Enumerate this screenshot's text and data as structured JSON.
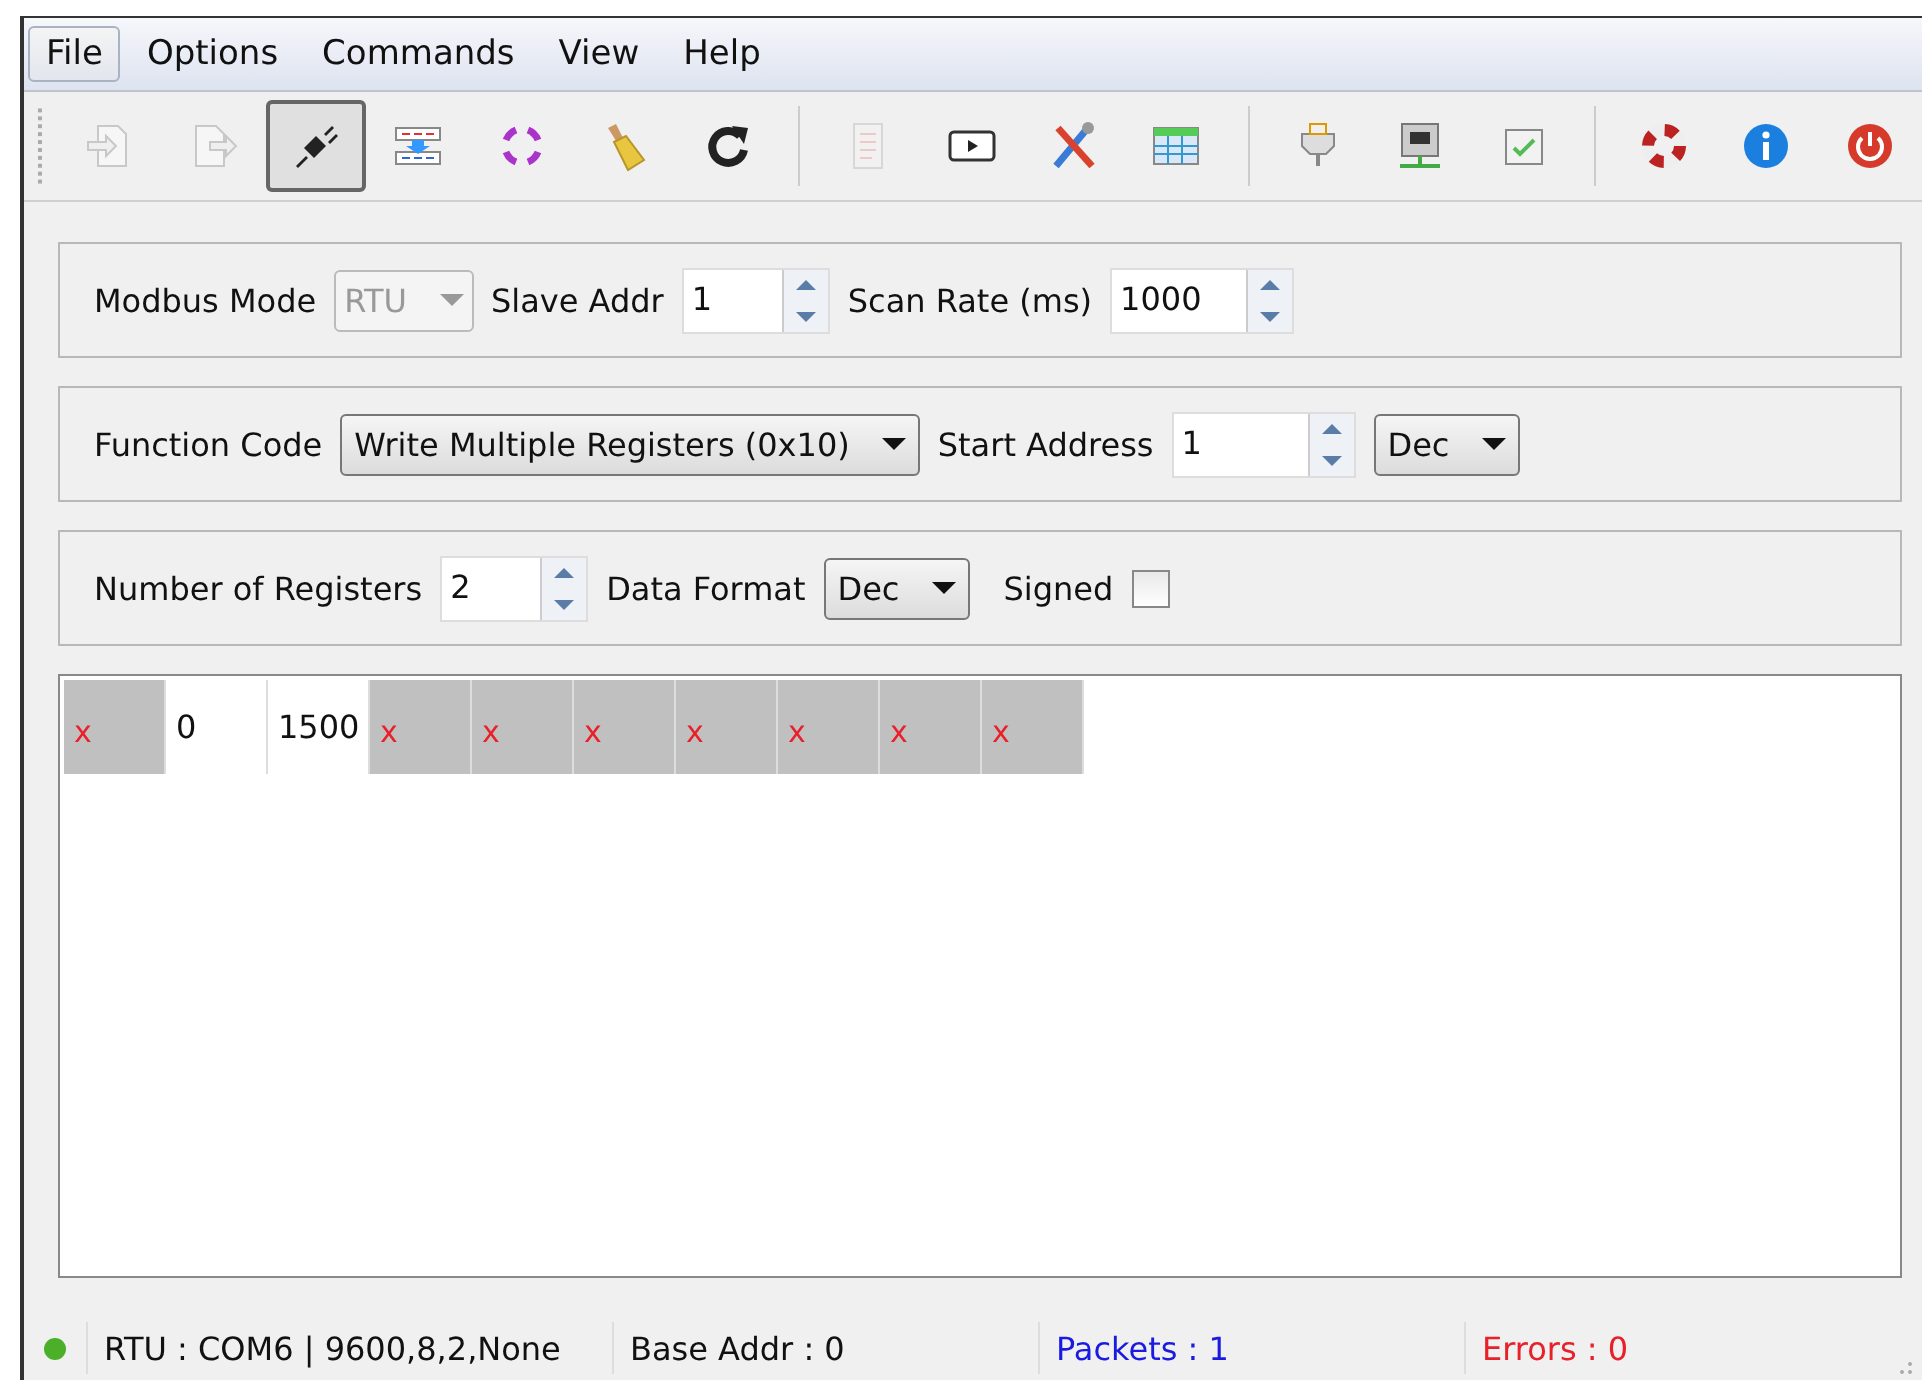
{
  "menu": [
    {
      "label": "File",
      "selected": true
    },
    {
      "label": "Options",
      "selected": false
    },
    {
      "label": "Commands",
      "selected": false
    },
    {
      "label": "View",
      "selected": false
    },
    {
      "label": "Help",
      "selected": false
    }
  ],
  "toolbar": [
    [
      {
        "kind": "load",
        "disabled": true,
        "on": false
      },
      {
        "kind": "save",
        "disabled": true,
        "on": false
      },
      {
        "kind": "connect",
        "disabled": false,
        "on": true
      },
      {
        "kind": "read-write",
        "disabled": false,
        "on": false
      },
      {
        "kind": "scan",
        "disabled": false,
        "on": false
      },
      {
        "kind": "clear",
        "disabled": false,
        "on": false
      },
      {
        "kind": "reset",
        "disabled": false,
        "on": false
      }
    ],
    [
      {
        "kind": "log",
        "disabled": true,
        "on": false
      },
      {
        "kind": "monitor",
        "disabled": false,
        "on": false
      },
      {
        "kind": "tools",
        "disabled": false,
        "on": false
      },
      {
        "kind": "table",
        "disabled": false,
        "on": false
      }
    ],
    [
      {
        "kind": "serial",
        "disabled": false,
        "on": false
      },
      {
        "kind": "network",
        "disabled": false,
        "on": false
      },
      {
        "kind": "check",
        "disabled": false,
        "on": false
      }
    ],
    [
      {
        "kind": "help",
        "disabled": false,
        "on": false
      },
      {
        "kind": "info",
        "disabled": false,
        "on": false
      },
      {
        "kind": "exit",
        "disabled": false,
        "on": false
      }
    ]
  ],
  "settings": {
    "modbus_mode": {
      "label": "Modbus Mode",
      "value": "RTU",
      "disabled": true
    },
    "slave_addr": {
      "label": "Slave Addr",
      "value": "1"
    },
    "scan_rate": {
      "label": "Scan Rate (ms)",
      "value": "1000"
    }
  },
  "function": {
    "function_code": {
      "label": "Function Code",
      "value": "Write Multiple Registers (0x10)"
    },
    "start_address": {
      "label": "Start Address",
      "value": "1"
    },
    "address_format": {
      "value": "Dec"
    }
  },
  "registers": {
    "number": {
      "label": "Number of Registers",
      "value": "2"
    },
    "data_format": {
      "label": "Data Format",
      "value": "Dec"
    },
    "signed": {
      "label": "Signed",
      "checked": false
    }
  },
  "cells": [
    {
      "kind": "empty",
      "text": "x"
    },
    {
      "kind": "value",
      "text": "0"
    },
    {
      "kind": "value",
      "text": "1500"
    },
    {
      "kind": "empty",
      "text": "x"
    },
    {
      "kind": "empty",
      "text": "x"
    },
    {
      "kind": "empty",
      "text": "x"
    },
    {
      "kind": "empty",
      "text": "x"
    },
    {
      "kind": "empty",
      "text": "x"
    },
    {
      "kind": "empty",
      "text": "x"
    },
    {
      "kind": "empty",
      "text": "x"
    }
  ],
  "status_bar": {
    "connection": "RTU : COM6 | 9600,8,2,None",
    "base_addr": "Base Addr : 0",
    "packets": "Packets : 1",
    "errors": "Errors : 0"
  }
}
